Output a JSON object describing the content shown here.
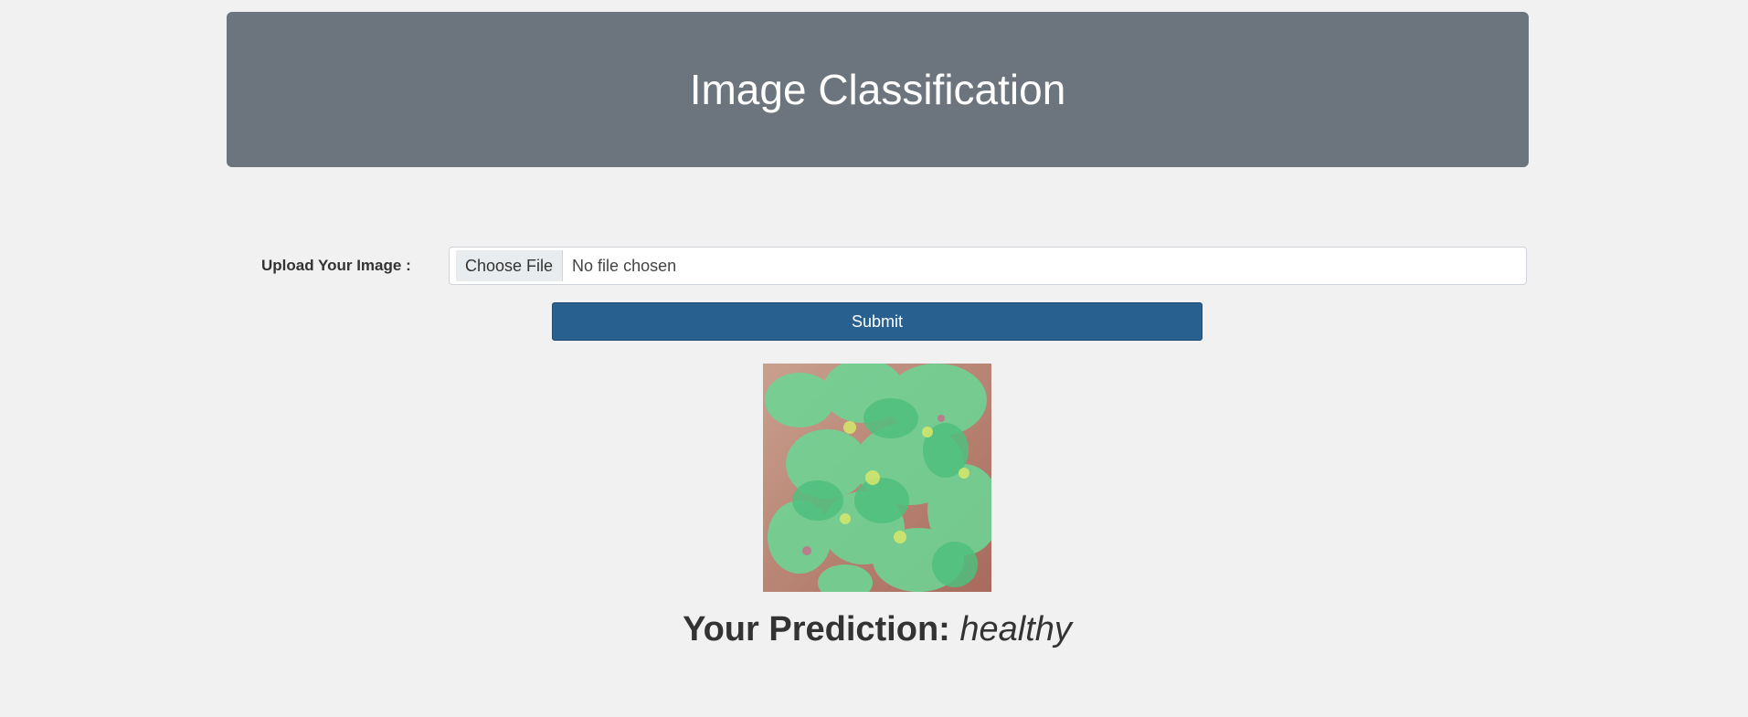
{
  "header": {
    "title": "Image Classification"
  },
  "form": {
    "upload_label": "Upload Your Image :",
    "choose_file_label": "Choose File",
    "file_status": "No file chosen",
    "submit_label": "Submit"
  },
  "preview": {
    "icon": "plant-leaves-image"
  },
  "result": {
    "label": "Your Prediction:",
    "value": "healthy"
  },
  "colors": {
    "background": "#f1f1f1",
    "header": "#6c757d",
    "submit": "#286090"
  }
}
